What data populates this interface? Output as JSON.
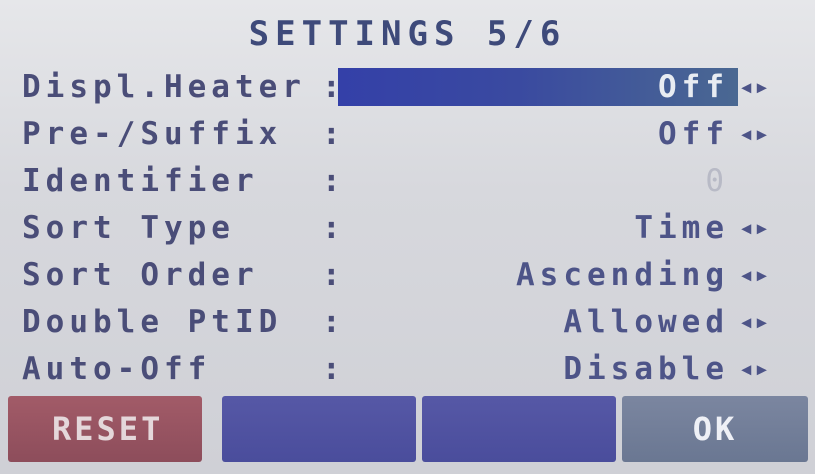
{
  "screen": {
    "title": "SETTINGS 5/6"
  },
  "settings": [
    {
      "label": "Displ.Heater",
      "value": "Off",
      "selected": true,
      "arrows": "◂▸"
    },
    {
      "label": "Pre-/Suffix",
      "value": "Off",
      "selected": false,
      "arrows": "◂▸"
    },
    {
      "label": "Identifier",
      "value": "0",
      "selected": false,
      "arrows": ""
    },
    {
      "label": "Sort Type",
      "value": "Time",
      "selected": false,
      "arrows": "◂▸"
    },
    {
      "label": "Sort Order",
      "value": "Ascending",
      "selected": false,
      "arrows": "◂▸"
    },
    {
      "label": "Double PtID",
      "value": "Allowed",
      "selected": false,
      "arrows": "◂▸"
    },
    {
      "label": "Auto-Off",
      "value": "Disable",
      "selected": false,
      "arrows": "◂▸"
    }
  ],
  "separator": ":",
  "softkeys": {
    "f1": "RESET",
    "f2": "",
    "f3": "",
    "f4": "OK"
  },
  "colors": {
    "highlight": "#3a46a6",
    "text": "#4a4d78",
    "softkey": "#4f51a0",
    "reset": "#9a5563",
    "ok": "#72809a"
  }
}
